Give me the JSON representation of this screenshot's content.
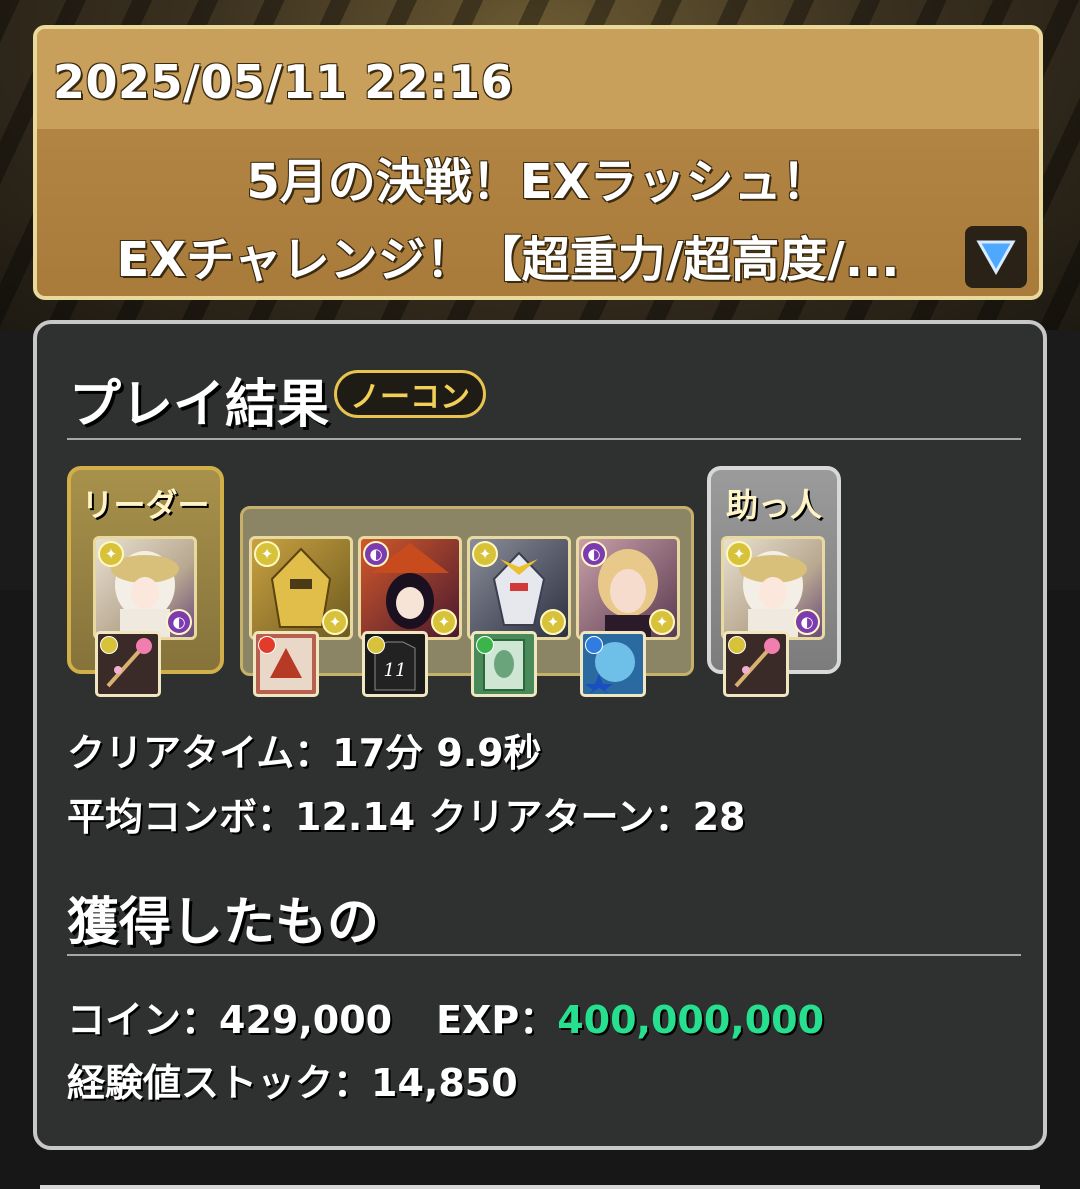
{
  "header": {
    "timestamp": "2025/05/11 22:16",
    "event_line1": "5月の決戦！EXラッシュ！",
    "event_line2": "EXチャレンジ！【超重力/超高度/..."
  },
  "result": {
    "title": "プレイ結果",
    "badge": "ノーコン",
    "leader_label": "リーダー",
    "helper_label": "助っ人",
    "clear_time_label": "クリアタイム：",
    "clear_time_value": "17分 9.9秒",
    "avg_combo_label": "平均コンボ：",
    "avg_combo_value": "12.14",
    "clear_turn_label": "クリアターン：",
    "clear_turn_value": "28"
  },
  "rewards": {
    "title": "獲得したもの",
    "coin_label": "コイン：",
    "coin_value": "429,000",
    "exp_label": "EXP：",
    "exp_value": "400,000,000",
    "stock_label": "経験値ストック：",
    "stock_value": "14,850"
  },
  "team": {
    "leader": {
      "icon": "white-haired-leader-portrait-icon",
      "weapon": "pink-staff-weapon-icon"
    },
    "members": [
      {
        "icon": "gold-armored-robot-portrait-icon",
        "weapon": "red-dragon-weapon-icon",
        "weapon_color": "red"
      },
      {
        "icon": "witch-hat-girl-portrait-icon",
        "weapon": "black-jersey-11-weapon-icon",
        "weapon_text": "11",
        "weapon_color": "yellow"
      },
      {
        "icon": "white-mecha-portrait-icon",
        "weapon": "green-card-weapon-icon",
        "weapon_color": "green"
      },
      {
        "icon": "blonde-woman-portrait-icon",
        "weapon": "blue-star-weapon-icon",
        "weapon_color": "blue"
      }
    ],
    "helper": {
      "icon": "white-haired-helper-portrait-icon",
      "weapon": "pink-staff-weapon-icon"
    }
  },
  "colors": {
    "exp_value": "#27e08f",
    "badge": "#f2cf58",
    "panel": "#2f3131"
  }
}
